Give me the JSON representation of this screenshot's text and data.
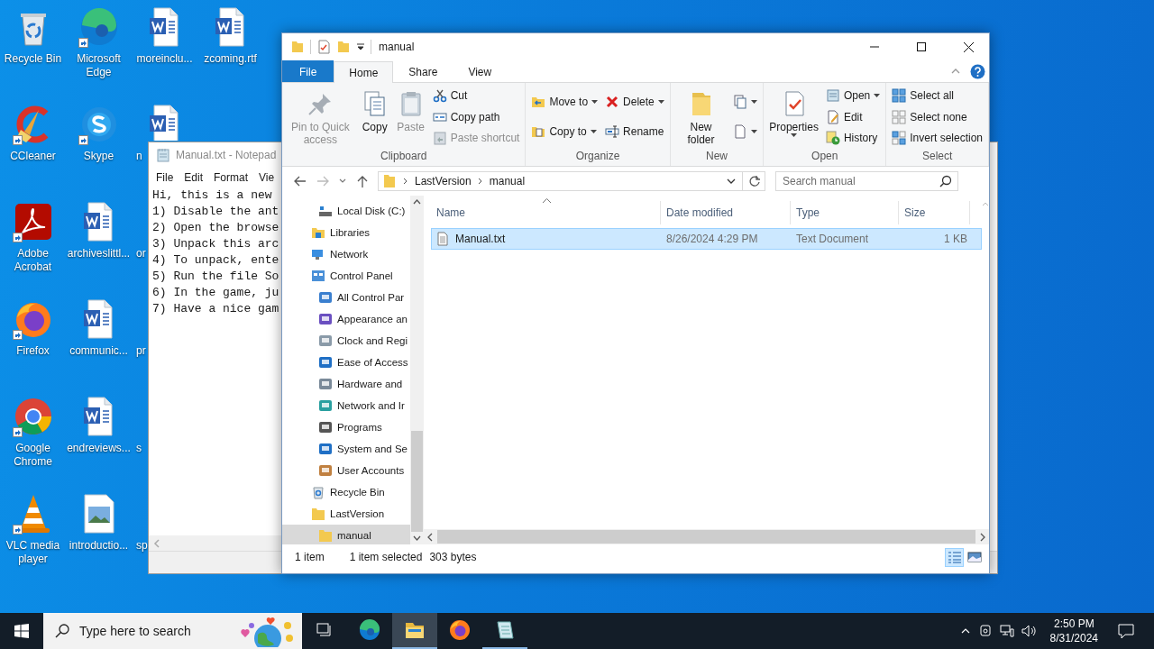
{
  "desktop": {
    "icons": [
      {
        "label": "Recycle Bin",
        "kind": "recycle",
        "shortcut": false,
        "clipped": false
      },
      {
        "label": "CCleaner",
        "kind": "ccleaner",
        "shortcut": true,
        "clipped": false
      },
      {
        "label": "Adobe Acrobat",
        "kind": "acrobat",
        "shortcut": true,
        "clipped": false
      },
      {
        "label": "Firefox",
        "kind": "firefox",
        "shortcut": true,
        "clipped": false
      },
      {
        "label": "Google Chrome",
        "kind": "chrome",
        "shortcut": true,
        "clipped": false
      },
      {
        "label": "VLC media player",
        "kind": "vlc",
        "shortcut": true,
        "clipped": false
      },
      {
        "label": "Microsoft Edge",
        "kind": "edge",
        "shortcut": true,
        "clipped": false
      },
      {
        "label": "Skype",
        "kind": "skype",
        "shortcut": true,
        "clipped": false
      },
      {
        "label": "archiveslittl...",
        "kind": "word",
        "shortcut": false,
        "clipped": false
      },
      {
        "label": "communic...",
        "kind": "word",
        "shortcut": false,
        "clipped": false
      },
      {
        "label": "endreviews...",
        "kind": "word",
        "shortcut": false,
        "clipped": false
      },
      {
        "label": "introductio...",
        "kind": "image",
        "shortcut": false,
        "clipped": false
      },
      {
        "label": "moreinclu...",
        "kind": "word",
        "shortcut": false,
        "clipped": false
      },
      {
        "label": "n",
        "kind": "word",
        "shortcut": false,
        "clipped": true
      },
      {
        "label": "or",
        "kind": "hidden",
        "clipped": true
      },
      {
        "label": "pr",
        "kind": "hidden",
        "clipped": true
      },
      {
        "label": "s",
        "kind": "hidden",
        "clipped": true
      },
      {
        "label": "sp",
        "kind": "hidden",
        "clipped": true
      },
      {
        "label": "zcoming.rtf",
        "kind": "word",
        "shortcut": false,
        "clipped": false
      }
    ]
  },
  "notepad": {
    "title": "Manual.txt - Notepad",
    "menu": [
      "File",
      "Edit",
      "Format",
      "Vie"
    ],
    "lines": [
      "Hi, this is a new",
      "1) Disable the ant",
      "2) Open the browse",
      "3) Unpack this arc",
      "4) To unpack, ente",
      "5) Run the file So",
      "6) In the game, ju",
      "7) Have a nice gam"
    ]
  },
  "explorer": {
    "title": "manual",
    "ribbon_tabs": [
      {
        "label": "File",
        "kind": "file",
        "selected": false
      },
      {
        "label": "Home",
        "kind": "tab",
        "selected": true
      },
      {
        "label": "Share",
        "kind": "tab",
        "selected": false
      },
      {
        "label": "View",
        "kind": "tab",
        "selected": false
      }
    ],
    "ribbon_groups": [
      {
        "label": "Clipboard",
        "items": [
          {
            "kind": "large",
            "label": "Pin to Quick access",
            "disabled": true,
            "dropdown": false
          },
          {
            "kind": "large",
            "label": "Copy",
            "disabled": false,
            "dropdown": false
          },
          {
            "kind": "large",
            "label": "Paste",
            "disabled": true,
            "dropdown": false
          },
          {
            "kind": "stack",
            "commands": [
              {
                "label": "Cut",
                "disabled": false,
                "dropdown": false
              },
              {
                "label": "Copy path",
                "disabled": false,
                "dropdown": false
              },
              {
                "label": "Paste shortcut",
                "disabled": true,
                "dropdown": false
              }
            ]
          }
        ]
      },
      {
        "label": "Organize",
        "items": [
          {
            "kind": "stack",
            "commands": [
              {
                "label": "Move to",
                "disabled": false,
                "dropdown": true
              },
              {
                "label": "Copy to",
                "disabled": false,
                "dropdown": true
              }
            ]
          },
          {
            "kind": "stack",
            "commands": [
              {
                "label": "Delete",
                "disabled": false,
                "dropdown": true
              },
              {
                "label": "Rename",
                "disabled": false,
                "dropdown": false
              }
            ]
          }
        ]
      },
      {
        "label": "New",
        "items": [
          {
            "kind": "large",
            "label": "New folder",
            "disabled": false,
            "dropdown": false
          },
          {
            "kind": "stack",
            "commands": [
              {
                "dropdown": true
              },
              {
                "dropdown": true
              }
            ]
          }
        ]
      },
      {
        "label": "Open",
        "items": [
          {
            "kind": "large",
            "label": "Properties",
            "disabled": false,
            "dropdown": true
          },
          {
            "kind": "stack",
            "commands": [
              {
                "label": "Open",
                "disabled": false,
                "dropdown": true
              },
              {
                "label": "Edit",
                "disabled": false,
                "dropdown": false
              },
              {
                "label": "History",
                "disabled": false,
                "dropdown": false
              }
            ]
          }
        ]
      },
      {
        "label": "Select",
        "items": [
          {
            "kind": "stack",
            "commands": [
              {
                "label": "Select all",
                "disabled": false,
                "dropdown": false
              },
              {
                "label": "Select none",
                "disabled": false,
                "dropdown": false
              },
              {
                "label": "Invert selection",
                "disabled": false,
                "dropdown": false
              }
            ]
          }
        ]
      }
    ],
    "address": {
      "crumbs": [
        "LastVersion",
        "manual"
      ]
    },
    "search": {
      "placeholder": "Search manual"
    },
    "nav": [
      {
        "children": [
          {
            "label": "Local Disk (C:)",
            "kind": "disk",
            "selected": false
          }
        ]
      },
      {
        "label": "Libraries",
        "kind": "libraries",
        "selected": false
      },
      {
        "label": "Network",
        "kind": "network",
        "selected": false
      },
      {
        "label": "Control Panel",
        "kind": "control",
        "selected": false,
        "children": [
          {
            "label": "All Control Par",
            "kind": "applet",
            "selected": false
          },
          {
            "label": "Appearance an",
            "kind": "applet",
            "selected": false
          },
          {
            "label": "Clock and Regi",
            "kind": "applet",
            "selected": false
          },
          {
            "label": "Ease of Access",
            "kind": "applet",
            "selected": false
          },
          {
            "label": "Hardware and",
            "kind": "applet",
            "selected": false
          },
          {
            "label": "Network and Ir",
            "kind": "applet",
            "selected": false
          },
          {
            "label": "Programs",
            "kind": "applet",
            "selected": false
          },
          {
            "label": "System and Se",
            "kind": "applet",
            "selected": false
          },
          {
            "label": "User Accounts",
            "kind": "applet",
            "selected": false
          }
        ]
      },
      {
        "label": "Recycle Bin",
        "kind": "recycle",
        "selected": false
      },
      {
        "label": "LastVersion",
        "kind": "folder",
        "selected": false,
        "children": [
          {
            "label": "manual",
            "kind": "folder",
            "selected": true
          }
        ]
      }
    ],
    "columns": [
      "Name",
      "Date modified",
      "Type",
      "Size"
    ],
    "files": [
      {
        "name": "Manual.txt",
        "date": "8/26/2024 4:29 PM",
        "type": "Text Document",
        "size": "1 KB",
        "selected": true
      }
    ],
    "status": {
      "count": "1 item",
      "selection": "1 item selected",
      "size": "303 bytes"
    },
    "views": [
      {
        "kind": "details",
        "selected": true
      },
      {
        "kind": "large_icons",
        "selected": false
      }
    ]
  },
  "taskbar": {
    "search": {
      "placeholder": "Type here to search"
    },
    "apps": [
      {
        "kind": "taskview",
        "running": false,
        "selected": false
      },
      {
        "kind": "edge",
        "running": false,
        "selected": false
      },
      {
        "kind": "explorer",
        "running": true,
        "selected": true
      },
      {
        "kind": "firefox",
        "running": false,
        "selected": false
      },
      {
        "kind": "notepad",
        "running": true,
        "selected": false
      }
    ],
    "clock": {
      "time": "2:50 PM",
      "date": "8/31/2024"
    }
  }
}
